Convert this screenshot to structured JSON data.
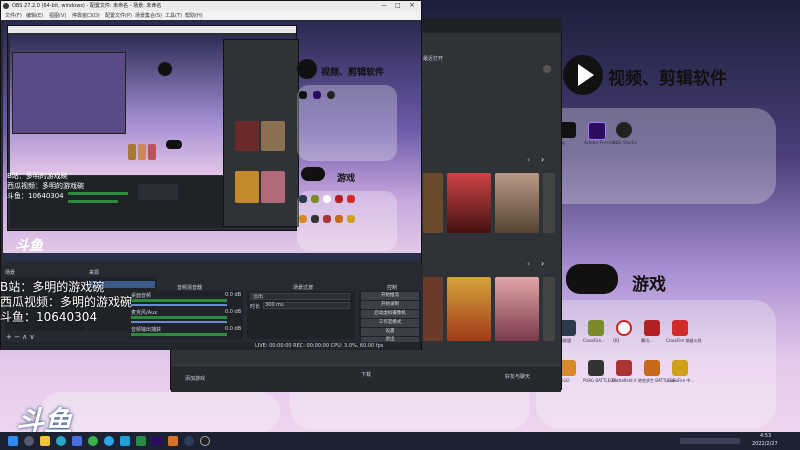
{
  "desktop": {
    "tile_video_text": "视频、剪辑软件",
    "tile_games_text": "游戏",
    "app_labels": [
      "剪映",
      "Adobe Premie...",
      "OBS Studio"
    ],
    "game_labels": [
      "英雄联盟",
      "CrossFire...",
      "QQ",
      "腾讯...",
      "CrossFire 穿越火线",
      "CSGO",
      "PUBG BATTLEGR...",
      "Battlefield V",
      "绝地求生 BATTLEGR...",
      "CrossFire 中..."
    ]
  },
  "obs": {
    "title": "OBS 27.2.0 (64-bit, windows) - 配置文件: 未命名 - 场景: 未命名",
    "menu": [
      "文件(F)",
      "编辑(E)",
      "视图(V)",
      "停靠窗口(D)",
      "配置文件(P)",
      "场景集合(S)",
      "工具(T)",
      "帮助(H)"
    ],
    "preview_overlay_lines": [
      "B站：多明的游戏碗",
      "西瓜视频：多明的游戏碗",
      "斗鱼：10640304"
    ],
    "inner_overlay_lines": [
      "B站：多明的游戏碗",
      "西瓜视频：多明的游戏碗",
      "斗鱼：10640304"
    ],
    "douyu_logo": "斗鱼",
    "docks": {
      "scenes_tab": "场景",
      "sources_tab": "来源",
      "mixer": "音频混音器",
      "transitions": "场景过渡",
      "controls": "控制"
    },
    "mixer_tracks": [
      {
        "name": "桌面音频",
        "db": "0.0 dB"
      },
      {
        "name": "麦克风/Aux",
        "db": "0.0 dB"
      },
      {
        "name": "音频输出捕获",
        "db": "0.0 dB"
      }
    ],
    "transition": {
      "type": "淡出",
      "duration_label": "时长",
      "duration": "300 ms"
    },
    "controls": [
      "开始推流",
      "开始录制",
      "启动虚拟摄像机",
      "工作室模式",
      "设置",
      "退出"
    ],
    "status": "LIVE: 00:00:00   REC: 00:00:00   CPU: 3.0%, 60.00 fps"
  },
  "launcher": {
    "header_label": "最近打开",
    "bottom_left": "添加游戏",
    "bottom_mid": "下载",
    "bottom_right": "好友与聊天"
  },
  "taskbar": {
    "time": "4:53",
    "date": "2022/2/27"
  }
}
